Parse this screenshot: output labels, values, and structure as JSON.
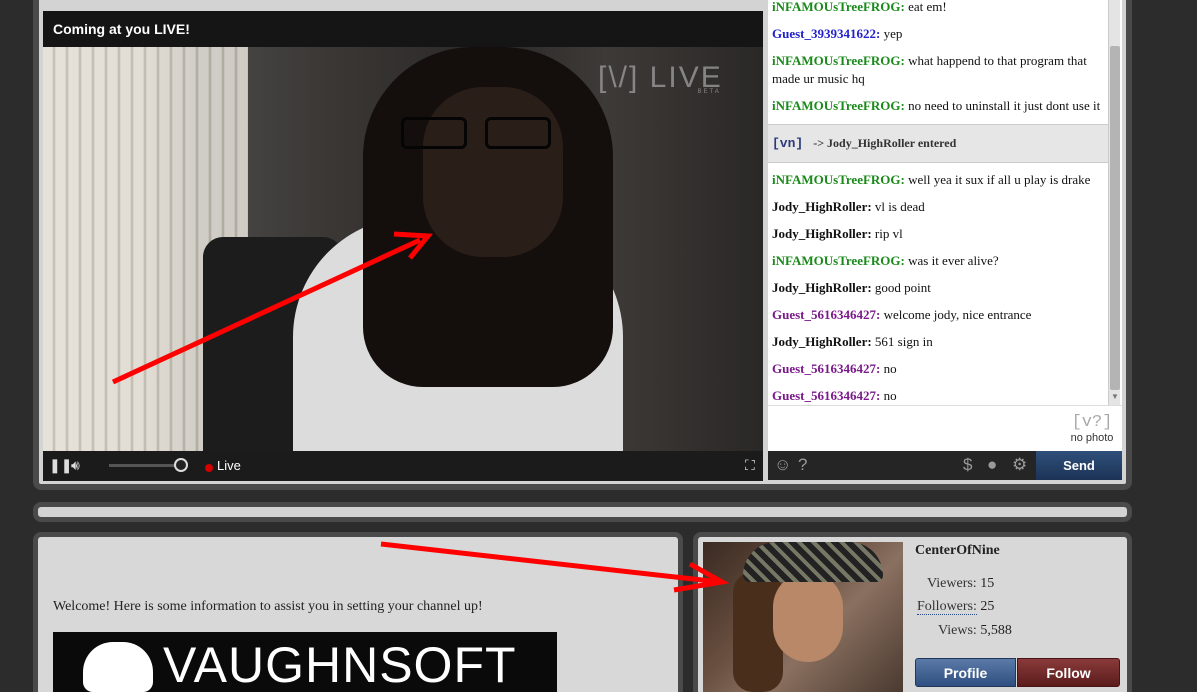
{
  "video": {
    "title": "Coming at you LIVE!",
    "watermark": "[\\/] LIVE",
    "watermark_beta": "BETA",
    "live_label": "Live"
  },
  "chat": {
    "messages": [
      {
        "user": "iNFAMOUsTreeFROG:",
        "text": " eat em!",
        "color": "green"
      },
      {
        "user": "Guest_3939341622:",
        "text": " yep",
        "color": "blue"
      },
      {
        "user": "iNFAMOUsTreeFROG:",
        "text": " what happend to that program that made ur music hq",
        "color": "green"
      },
      {
        "user": "iNFAMOUsTreeFROG:",
        "text": " no need to uninstall it just dont use it",
        "color": "green"
      }
    ],
    "system": {
      "logo": "[vn]",
      "text": "-> Jody_HighRoller entered"
    },
    "messages2": [
      {
        "user": "iNFAMOUsTreeFROG:",
        "text": " well yea it sux if all u play is drake",
        "color": "green"
      },
      {
        "user": "Jody_HighRoller:",
        "text": " vl is dead",
        "color": "black"
      },
      {
        "user": "Jody_HighRoller:",
        "text": " rip vl",
        "color": "black"
      },
      {
        "user": "iNFAMOUsTreeFROG:",
        "text": " was it ever alive?",
        "color": "green"
      },
      {
        "user": "Jody_HighRoller:",
        "text": " good point",
        "color": "black"
      },
      {
        "user": "Guest_5616346427:",
        "text": " welcome jody, nice entrance",
        "color": "purple"
      },
      {
        "user": "Jody_HighRoller:",
        "text": " 561 sign in",
        "color": "black"
      },
      {
        "user": "Guest_5616346427:",
        "text": " no",
        "color": "purple"
      },
      {
        "user": "Guest_5616346427:",
        "text": " no",
        "color": "purple"
      }
    ],
    "no_photo_logo": "[v?]",
    "no_photo_text": "no photo",
    "send_label": "Send"
  },
  "info": {
    "welcome": "Welcome! Here is some information to assist you in setting your channel up!",
    "banner_text": "VAUGHNSOFT"
  },
  "profile": {
    "channel_name": "CenterOfNine",
    "viewers_label": "Viewers:",
    "viewers": "15",
    "followers_label": "Followers:",
    "followers": "25",
    "views_label": "Views:",
    "views": "5,588",
    "profile_label": "Profile",
    "follow_label": "Follow"
  },
  "colors": {
    "accent_green": "#1a8a1a",
    "accent_blue": "#2222cc",
    "accent_purple": "#7a1a8a",
    "send_blue": "#1c3356",
    "follow_red": "#5c1c1c",
    "arrow_red": "#ff0000"
  }
}
